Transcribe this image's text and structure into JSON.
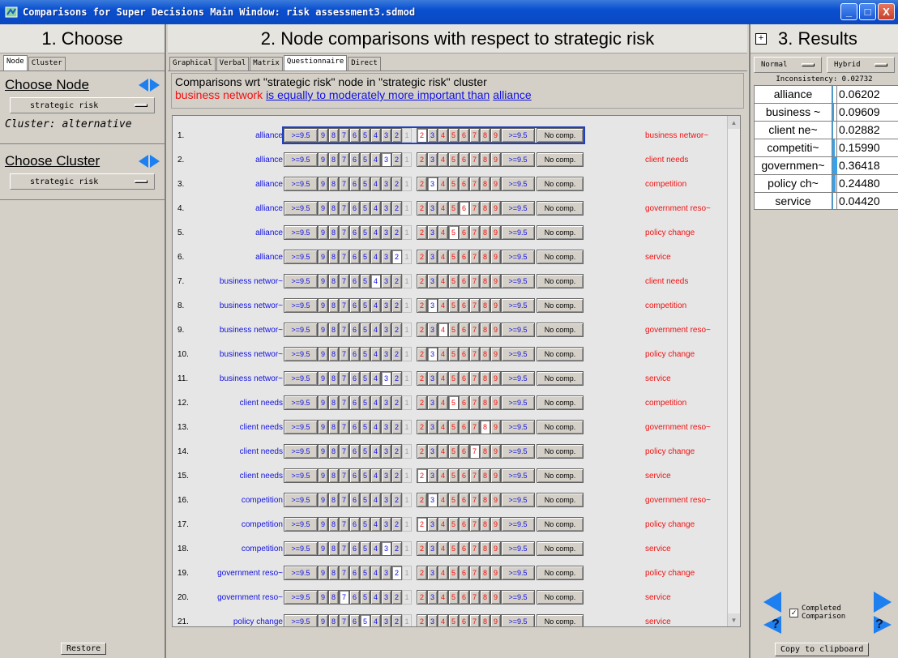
{
  "window": {
    "title": "Comparisons for Super Decisions Main Window: risk assessment3.sdmod",
    "minimize": "_",
    "maximize": "□",
    "close": "X"
  },
  "left": {
    "heading": "1. Choose",
    "tabs": [
      "Node",
      "Cluster"
    ],
    "choose_node_label": "Choose Node",
    "node_value": "strategic risk",
    "cluster_text": "Cluster: alternative",
    "choose_cluster_label": "Choose Cluster",
    "cluster_value": "strategic risk",
    "restore": "Restore"
  },
  "mid": {
    "heading": "2. Node comparisons with respect to strategic risk",
    "tabs": [
      "Graphical",
      "Verbal",
      "Matrix",
      "Questionnaire",
      "Direct"
    ],
    "header_line1": "Comparisons wrt \"strategic risk\" node in \"strategic risk\" cluster",
    "header_line2_left": "business network",
    "header_line2_mid": "is equally to moderately more important than",
    "header_line2_right": "alliance",
    "scale_left": [
      ">=9.5",
      "9",
      "8",
      "7",
      "6",
      "5",
      "4",
      "3",
      "2"
    ],
    "scale_one": "1",
    "scale_right": [
      "2",
      "3",
      "4",
      "5",
      "6",
      "7",
      "8",
      "9",
      ">=9.5"
    ],
    "no_comp": "No comp.",
    "rows": [
      {
        "num": "1.",
        "left": "alliance",
        "right": "business networ~",
        "side": "R",
        "val": "2"
      },
      {
        "num": "2.",
        "left": "alliance",
        "right": "client needs",
        "side": "L",
        "val": "3"
      },
      {
        "num": "3.",
        "left": "alliance",
        "right": "competition",
        "side": "R",
        "val": "3"
      },
      {
        "num": "4.",
        "left": "alliance",
        "right": "government reso~",
        "side": "R",
        "val": "6"
      },
      {
        "num": "5.",
        "left": "alliance",
        "right": "policy change",
        "side": "R",
        "val": "5"
      },
      {
        "num": "6.",
        "left": "alliance",
        "right": "service",
        "side": "L",
        "val": "2"
      },
      {
        "num": "7.",
        "left": "business networ~",
        "right": "client needs",
        "side": "L",
        "val": "4"
      },
      {
        "num": "8.",
        "left": "business networ~",
        "right": "competition",
        "side": "R",
        "val": "3"
      },
      {
        "num": "9.",
        "left": "business networ~",
        "right": "government reso~",
        "side": "R",
        "val": "4"
      },
      {
        "num": "10.",
        "left": "business networ~",
        "right": "policy change",
        "side": "R",
        "val": "3"
      },
      {
        "num": "11.",
        "left": "business networ~",
        "right": "service",
        "side": "L",
        "val": "3"
      },
      {
        "num": "12.",
        "left": "client needs",
        "right": "competition",
        "side": "R",
        "val": "5"
      },
      {
        "num": "13.",
        "left": "client needs",
        "right": "government reso~",
        "side": "R",
        "val": "8"
      },
      {
        "num": "14.",
        "left": "client needs",
        "right": "policy change",
        "side": "R",
        "val": "7"
      },
      {
        "num": "15.",
        "left": "client needs",
        "right": "service",
        "side": "R",
        "val": "2"
      },
      {
        "num": "16.",
        "left": "competition",
        "right": "government reso~",
        "side": "R",
        "val": "3"
      },
      {
        "num": "17.",
        "left": "competition",
        "right": "policy change",
        "side": "R",
        "val": "2"
      },
      {
        "num": "18.",
        "left": "competition",
        "right": "service",
        "side": "L",
        "val": "3"
      },
      {
        "num": "19.",
        "left": "government reso~",
        "right": "policy change",
        "side": "L",
        "val": "2"
      },
      {
        "num": "20.",
        "left": "government reso~",
        "right": "service",
        "side": "L",
        "val": "7"
      },
      {
        "num": "21.",
        "left": "policy change",
        "right": "service",
        "side": "L",
        "val": "5"
      }
    ]
  },
  "right": {
    "plus": "+",
    "heading": "3. Results",
    "mode_left": "Normal",
    "mode_right": "Hybrid",
    "inconsistency": "Inconsistency: 0.02732",
    "results": [
      {
        "name": "alliance",
        "value": "0.06202",
        "fraction": 0.06202
      },
      {
        "name": "business ~",
        "value": "0.09609",
        "fraction": 0.09609
      },
      {
        "name": "client ne~",
        "value": "0.02882",
        "fraction": 0.02882
      },
      {
        "name": "competiti~",
        "value": "0.15990",
        "fraction": 0.1599
      },
      {
        "name": "governmen~",
        "value": "0.36418",
        "fraction": 0.36418
      },
      {
        "name": "policy ch~",
        "value": "0.24480",
        "fraction": 0.2448
      },
      {
        "name": "service",
        "value": "0.04420",
        "fraction": 0.0442
      }
    ],
    "completed_line1": "Completed",
    "completed_line2": "Comparison",
    "completed_checked": "✓",
    "copy": "Copy to clipboard"
  }
}
